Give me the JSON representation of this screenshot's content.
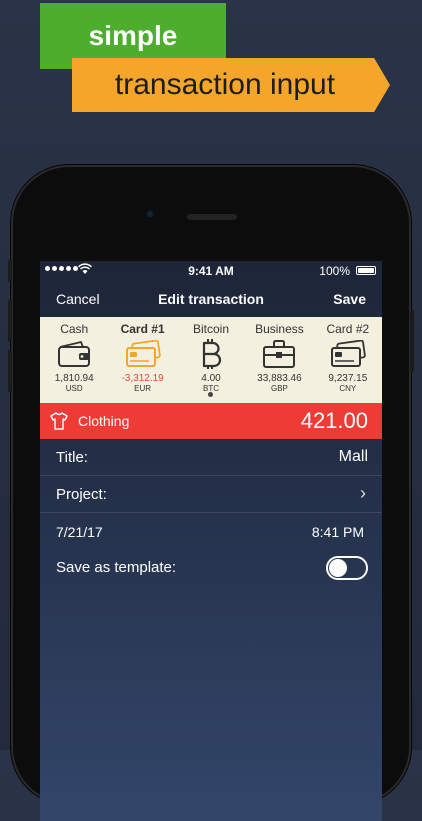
{
  "banner": {
    "top": "simple",
    "bottom": "transaction input"
  },
  "status": {
    "time": "9:41 AM",
    "battery": "100%"
  },
  "nav": {
    "cancel": "Cancel",
    "title": "Edit transaction",
    "save": "Save"
  },
  "accounts": [
    {
      "name": "Cash",
      "amount": "1,810.94",
      "currency": "USD",
      "icon": "wallet-icon"
    },
    {
      "name": "Card #1",
      "amount": "-3,312.19",
      "currency": "EUR",
      "icon": "credit-card-icon",
      "selected": true
    },
    {
      "name": "Bitcoin",
      "amount": "4.00",
      "currency": "BTC",
      "icon": "bitcoin-icon"
    },
    {
      "name": "Business",
      "amount": "33,883.46",
      "currency": "GBP",
      "icon": "briefcase-icon"
    },
    {
      "name": "Card #2",
      "amount": "9,237.15",
      "currency": "CNY",
      "icon": "credit-card-icon"
    }
  ],
  "category": {
    "name": "Clothing",
    "amount": "421.00",
    "icon": "shirt-icon",
    "color": "#ef3b36"
  },
  "form": {
    "title_label": "Title:",
    "title_value": "Mall",
    "project_label": "Project:",
    "date": "7/21/17",
    "time": "8:41 PM",
    "template_label": "Save as template:"
  },
  "colors": {
    "green": "#4cae2c",
    "orange": "#f4a62a",
    "accent_card": "#f4a62a",
    "negative": "#e8473e"
  }
}
